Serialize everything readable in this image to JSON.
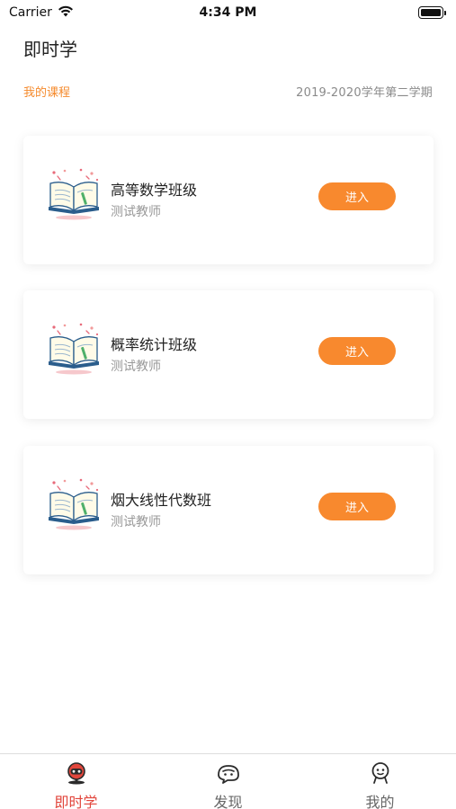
{
  "status_bar": {
    "carrier": "Carrier",
    "time": "4:34 PM"
  },
  "header": {
    "title": "即时学"
  },
  "section": {
    "label": "我的课程",
    "semester": "2019-2020学年第二学期"
  },
  "courses": [
    {
      "name": "高等数学班级",
      "teacher": "测试教师",
      "button": "进入",
      "icon": "open-book-icon"
    },
    {
      "name": "概率统计班级",
      "teacher": "测试教师",
      "button": "进入",
      "icon": "open-book-icon"
    },
    {
      "name": "烟大线性代数班",
      "teacher": "测试教师",
      "button": "进入",
      "icon": "open-book-icon"
    }
  ],
  "tab_bar": {
    "tabs": [
      {
        "label": "即时学",
        "icon": "bot-icon",
        "active": true
      },
      {
        "label": "发现",
        "icon": "discover-icon",
        "active": false
      },
      {
        "label": "我的",
        "icon": "profile-icon",
        "active": false
      }
    ]
  },
  "colors": {
    "accent": "#f8892e",
    "section_label": "#f58a2c",
    "tab_active": "#e2463c"
  }
}
